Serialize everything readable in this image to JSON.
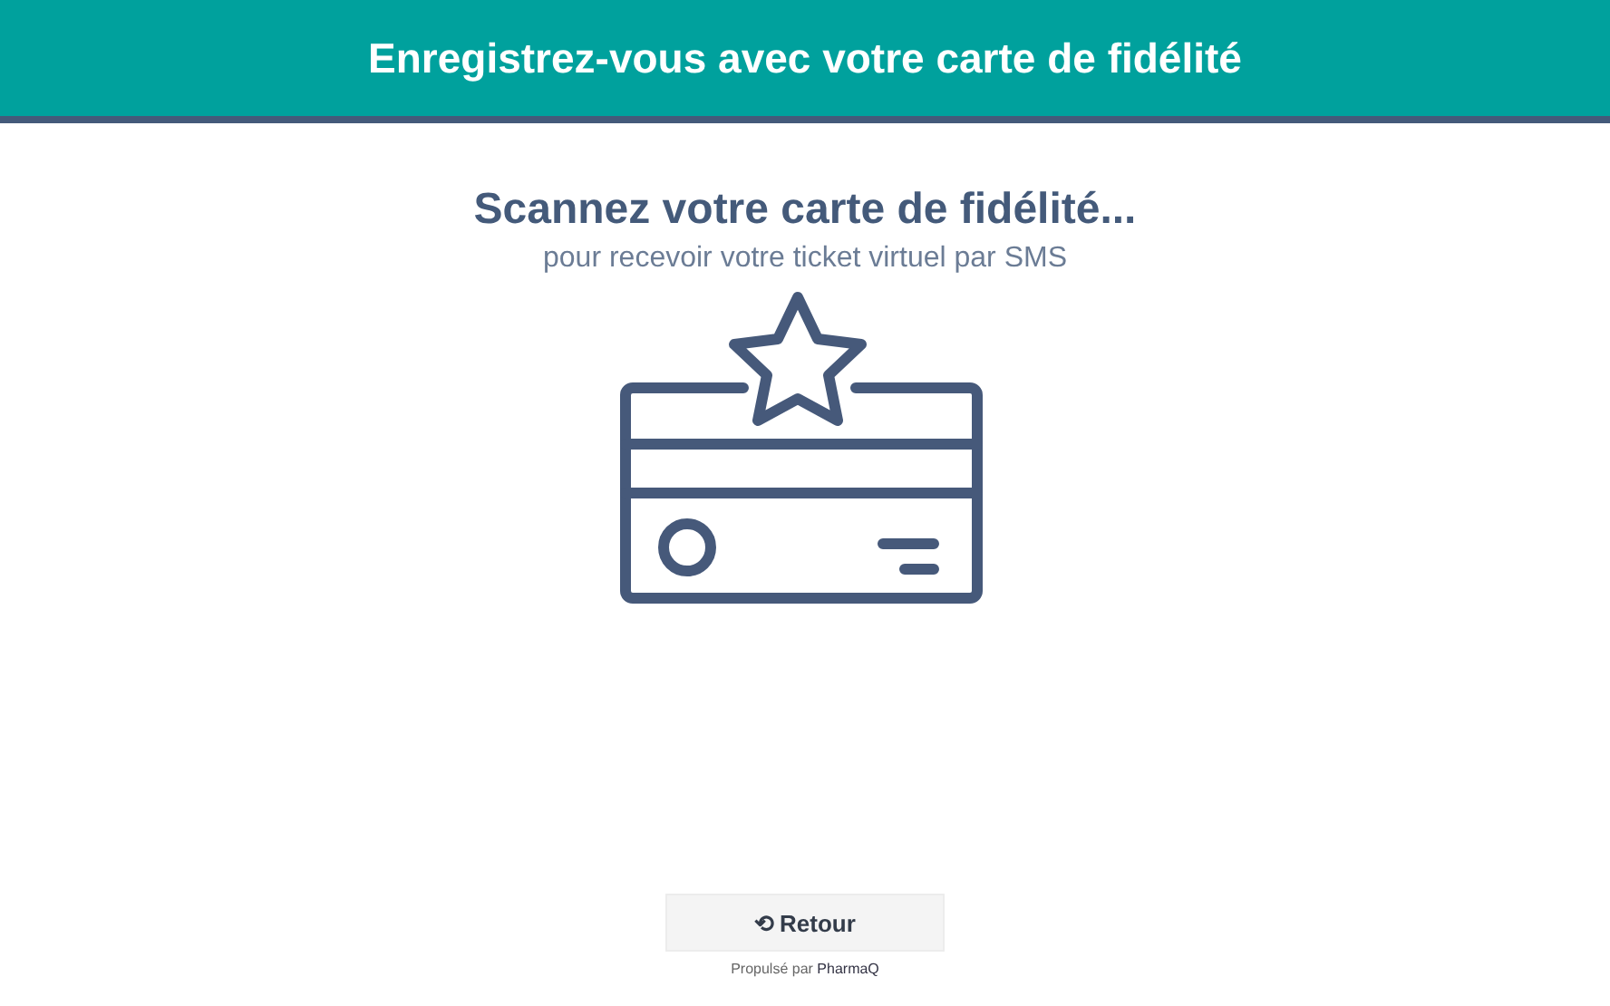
{
  "header": {
    "title": "Enregistrez-vous avec votre carte de fidélité"
  },
  "main": {
    "title": "Scannez votre carte de fidélité...",
    "subtitle": "pour recevoir votre ticket virtuel par SMS"
  },
  "back_button": {
    "icon": "⟲",
    "label": "Retour"
  },
  "footer": "Propulsé par **PharmaQ**"
}
